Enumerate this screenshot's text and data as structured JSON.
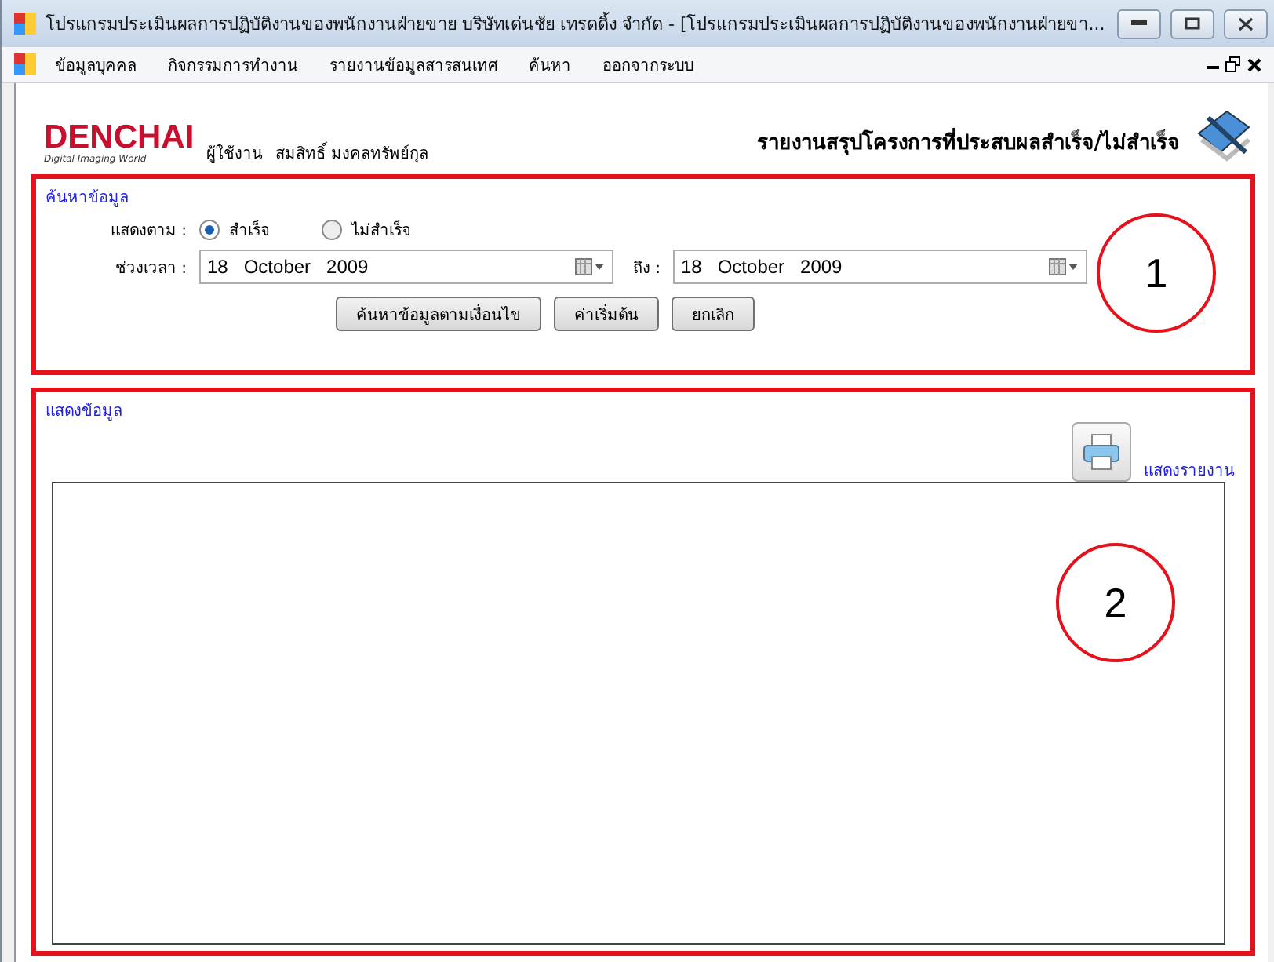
{
  "window": {
    "title": "โปรแกรมประเมินผลการปฏิบัติงานของพนักงานฝ่ายขาย บริษัทเด่นชัย เทรดดิ้ง จำกัด - [โปรแกรมประเมินผลการปฏิบัติงานของพนักงานฝ่ายขา..."
  },
  "menu": [
    "ข้อมูลบุคคล",
    "กิจกรรมการทำงาน",
    "รายงานข้อมูลสารสนเทศ",
    "ค้นหา",
    "ออกจากระบบ"
  ],
  "header": {
    "logo": "DENCHAI",
    "logo_tagline": "Digital Imaging World",
    "user_label": "ผู้ใช้งาน",
    "user_name": "สมสิทธิ์ มงคลทรัพย์กุล",
    "report_title": "รายงานสรุปโครงการที่ประสบผลสำเร็จ/ไม่สำเร็จ"
  },
  "search": {
    "group_title": "ค้นหาข้อมูล",
    "show_by_label": "แสดงตาม :",
    "options": [
      {
        "label": "สำเร็จ",
        "selected": true
      },
      {
        "label": "ไม่สำเร็จ",
        "selected": false
      }
    ],
    "period_label": "ช่วงเวลา :",
    "from_date": "18   October   2009",
    "to_label": "ถึง :",
    "to_date": "18   October   2009",
    "buttons": [
      "ค้นหาข้อมูลตามเงื่อนไข",
      "ค่าเริ่มต้น",
      "ยกเลิก"
    ],
    "annotation": "1"
  },
  "results": {
    "group_title": "แสดงข้อมูล",
    "report_link": "แสดงรายงาน",
    "annotation": "2"
  }
}
